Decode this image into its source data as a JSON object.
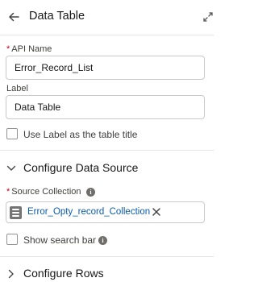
{
  "header": {
    "title": "Data Table",
    "back_icon": "back-arrow-icon",
    "expand_icon": "expand-icon"
  },
  "api_name": {
    "label": "API Name",
    "required_marker": "*",
    "value": "Error_Record_List"
  },
  "label_field": {
    "label": "Label",
    "value": "Data Table"
  },
  "use_label_as_title": {
    "label": "Use Label as the table title",
    "checked": false
  },
  "configure_data_source": {
    "title": "Configure Data Source",
    "expanded": true,
    "source_collection": {
      "label": "Source Collection",
      "required_marker": "*",
      "pill_icon": "collection-list-icon",
      "pill_text": "Error_Opty_record_Collection",
      "remove_icon": "close-icon"
    },
    "show_search_bar": {
      "label": "Show search bar",
      "checked": false
    }
  },
  "configure_rows": {
    "title": "Configure Rows",
    "expanded": false
  },
  "colors": {
    "required": "#ba0517",
    "link": "#0b5cab",
    "border": "#c9c9c9",
    "icon_gray": "#747474"
  }
}
